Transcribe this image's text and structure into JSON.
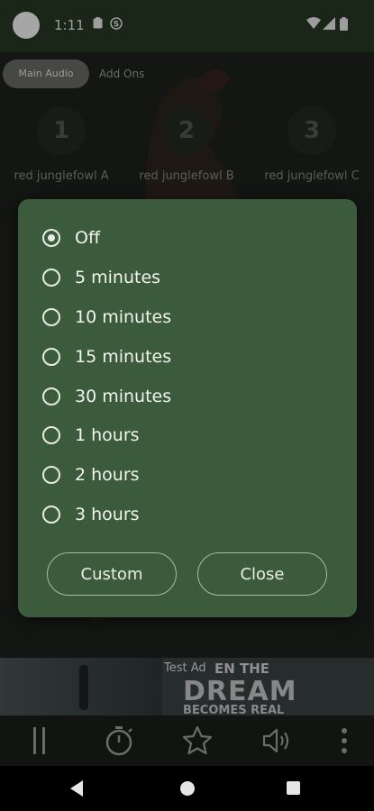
{
  "status_bar": {
    "time": "1:11",
    "icons": [
      "clipboard-icon",
      "s-app-icon"
    ],
    "right_icons": [
      "wifi-icon",
      "signal-icon",
      "battery-icon"
    ]
  },
  "tabs": [
    {
      "label": "Main Audio",
      "active": true
    },
    {
      "label": "Add Ons",
      "active": false
    }
  ],
  "cards": [
    {
      "num": "1",
      "label": "red junglefowl A"
    },
    {
      "num": "2",
      "label": "red junglefowl B"
    },
    {
      "num": "3",
      "label": "red junglefowl C"
    }
  ],
  "dialog": {
    "options": [
      "Off",
      "5 minutes",
      "10 minutes",
      "15 minutes",
      "30 minutes",
      "1 hours",
      "2 hours",
      "3 hours"
    ],
    "selected": "Off",
    "custom_label": "Custom",
    "close_label": "Close"
  },
  "ad": {
    "test_label": "Test Ad",
    "line1": "EN THE",
    "line2": "DREAM",
    "line3": "BECOMES REAL"
  },
  "bottom_bar": {
    "icons": [
      "pause-icon",
      "timer-icon",
      "star-icon",
      "volume-icon",
      "more-vert-icon"
    ]
  },
  "colors": {
    "dialog_bg": "#3c5a3c",
    "status_bar": "#283c25",
    "app_bg": "#20231e"
  }
}
